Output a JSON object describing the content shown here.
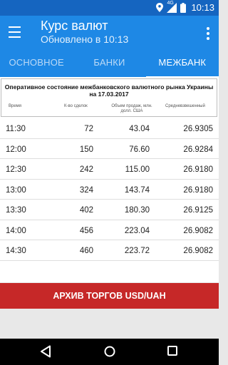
{
  "status_bar": {
    "network": "4G",
    "time": "10:13"
  },
  "app_bar": {
    "title": "Курс валют",
    "subtitle": "Обновлено в 10:13"
  },
  "tabs": [
    {
      "label": "ОСНОВНОЕ",
      "active": false
    },
    {
      "label": "БАНКИ",
      "active": false
    },
    {
      "label": "МЕЖБАНК",
      "active": true
    }
  ],
  "table": {
    "title": "Оперативное состояние межбанковского валютного рынка Украины на 17.03.2017",
    "columns": {
      "time": "Время",
      "deals": "К-во сделок",
      "volume": "Объем продаж, млн. долл. США",
      "rate": "Средневзвешенный"
    },
    "rows": [
      {
        "time": "11:30",
        "deals": "72",
        "volume": "43.04",
        "rate": "26.9305"
      },
      {
        "time": "12:00",
        "deals": "150",
        "volume": "76.60",
        "rate": "26.9284"
      },
      {
        "time": "12:30",
        "deals": "242",
        "volume": "115.00",
        "rate": "26.9180"
      },
      {
        "time": "13:00",
        "deals": "324",
        "volume": "143.74",
        "rate": "26.9180"
      },
      {
        "time": "13:30",
        "deals": "402",
        "volume": "180.30",
        "rate": "26.9125"
      },
      {
        "time": "14:00",
        "deals": "456",
        "volume": "223.04",
        "rate": "26.9082"
      },
      {
        "time": "14:30",
        "deals": "460",
        "volume": "223.72",
        "rate": "26.9082"
      }
    ]
  },
  "archive_button": {
    "label": "АРХИВ ТОРГОВ USD/UAH"
  },
  "colors": {
    "primary": "#1e88e5",
    "status_bar": "#1565c0",
    "accent_button": "#c62828"
  }
}
